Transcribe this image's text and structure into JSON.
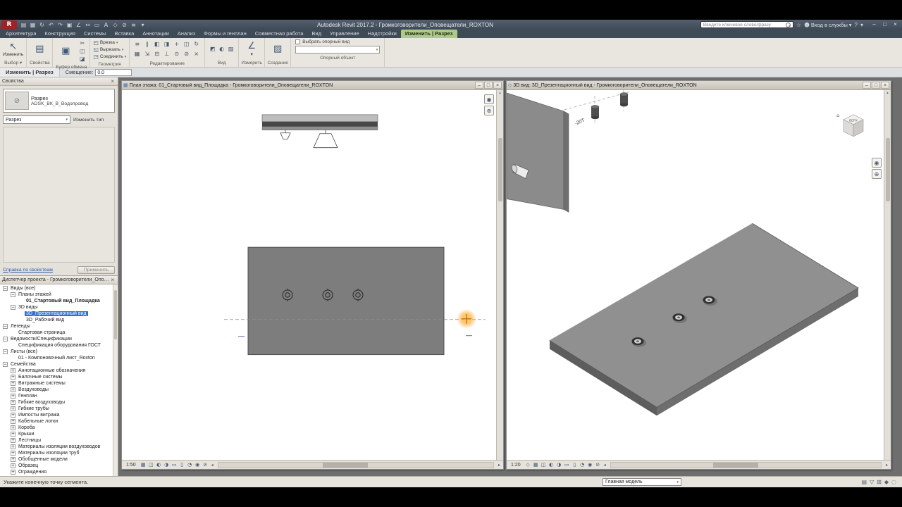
{
  "colors": {
    "tab-green": "#aec98a",
    "selection-blue": "#2f6fd0",
    "highlight-orange": "#ffa726",
    "slab-gray": "#909090"
  },
  "titlebar": {
    "logo_text": "R",
    "logo_arrow": "▾",
    "title": "Autodesk Revit 2017.2 - Громкоговорители_Оповещатели_ROXTON",
    "qat_icons": [
      {
        "name": "open-icon",
        "glyph": "▤"
      },
      {
        "name": "save-icon",
        "glyph": "▦"
      },
      {
        "name": "sync-icon",
        "glyph": "↻"
      },
      {
        "name": "undo-icon",
        "glyph": "↶"
      },
      {
        "name": "redo-icon",
        "glyph": "↷"
      },
      {
        "name": "print-icon",
        "glyph": "▣"
      },
      {
        "name": "measure-icon",
        "glyph": "∠"
      },
      {
        "name": "dimension-icon",
        "glyph": "↔"
      },
      {
        "name": "tag-icon",
        "glyph": "▭"
      },
      {
        "name": "text-icon",
        "glyph": "A"
      },
      {
        "name": "3d-view-icon",
        "glyph": "◇"
      },
      {
        "name": "section-icon",
        "glyph": "⊘"
      },
      {
        "name": "thin-lines-icon",
        "glyph": "≡"
      },
      {
        "name": "switch-windows-icon",
        "glyph": "▾"
      }
    ],
    "search_placeholder": "Введите ключевое слово/фразу",
    "star_icon": "☆",
    "person_icon": "☻",
    "signin_label": "Вход в службы",
    "signin_arrow": "▾",
    "help_label": "?",
    "help_arrow": "▾",
    "window_buttons": {
      "minimize": "–",
      "maximize": "□",
      "close": "×"
    }
  },
  "ribbon": {
    "dropdown_arrow": "▾",
    "tabs": [
      {
        "label": "Архитектура"
      },
      {
        "label": "Конструкция"
      },
      {
        "label": "Системы"
      },
      {
        "label": "Вставка"
      },
      {
        "label": "Аннотации"
      },
      {
        "label": "Анализ"
      },
      {
        "label": "Формы и генплан"
      },
      {
        "label": "Совместная работа"
      },
      {
        "label": "Вид"
      },
      {
        "label": "Управление"
      },
      {
        "label": "Надстройки"
      },
      {
        "label": "Изменить | Разрез",
        "active": true
      }
    ],
    "panels": {
      "select": {
        "label": "Выбор ▾",
        "button_label": "Изменить",
        "button_glyph": "↖"
      },
      "properties": {
        "label": "Свойства",
        "button_glyph": "▤"
      },
      "clipboard": {
        "label": "Буфер обмена",
        "paste_glyph": "▣",
        "small_icons": [
          {
            "name": "cut-icon",
            "glyph": "✂"
          },
          {
            "name": "copy-icon",
            "glyph": "◫"
          },
          {
            "name": "match-type-icon",
            "glyph": "◪"
          }
        ]
      },
      "geometry": {
        "label": "Геометрия",
        "buttons": [
          {
            "name": "cope-button",
            "label": "Врезка",
            "glyph": "◰"
          },
          {
            "name": "cut-geometry-button",
            "label": "Вырезать",
            "glyph": "◱"
          },
          {
            "name": "join-button",
            "label": "Соединить",
            "glyph": "◳"
          }
        ]
      },
      "modify": {
        "label": "Редактирование",
        "icons": [
          {
            "name": "align-icon",
            "glyph": "≡"
          },
          {
            "name": "offset-icon",
            "glyph": "∥"
          },
          {
            "name": "mirror-pick-icon",
            "glyph": "◧"
          },
          {
            "name": "mirror-axis-icon",
            "glyph": "◨"
          },
          {
            "name": "move-icon",
            "glyph": "+"
          },
          {
            "name": "copy-element-icon",
            "glyph": "◫"
          },
          {
            "name": "rotate-icon",
            "glyph": "↻"
          },
          {
            "name": "array-icon",
            "glyph": "▦"
          },
          {
            "name": "scale-icon",
            "glyph": "⇲"
          },
          {
            "name": "split-icon",
            "glyph": "⊟"
          },
          {
            "name": "trim-icon",
            "glyph": "⊥"
          },
          {
            "name": "pin-icon",
            "glyph": "⊙"
          },
          {
            "name": "unpin-icon",
            "glyph": "⊘"
          },
          {
            "name": "delete-icon",
            "glyph": "×"
          }
        ]
      },
      "view": {
        "label": "Вид",
        "icons": [
          {
            "name": "cut-profile-icon",
            "glyph": "◩"
          },
          {
            "name": "show-hidden-icon",
            "glyph": "◐"
          },
          {
            "name": "linework-icon",
            "glyph": "▨"
          }
        ]
      },
      "measure": {
        "label": "Измерить",
        "button_glyph": "∠"
      },
      "create": {
        "label": "Создание",
        "button_glyph": "▧"
      },
      "reference": {
        "label": "Опорный объект",
        "checkbox_label": "Выбрать опорный вид",
        "dropdown_value": ""
      }
    }
  },
  "options_bar": {
    "mode_label": "Изменить | Разрез",
    "offset_label": "Смещение:",
    "offset_value": "0.0"
  },
  "properties": {
    "header": "Свойства",
    "close_glyph": "×",
    "type_name": "Разрез",
    "type_family": "ADSK_ВК_В_Водопровод",
    "preview_glyph": "⊘",
    "selector_value": "Разрез",
    "edit_type_label": "Изменить тип",
    "help_link": "Справка по свойствам",
    "apply_label": "Применить"
  },
  "project_browser": {
    "header": "Диспетчер проекта - Громкоговорители_Оповещатели_ROXTON",
    "close_glyph": "×",
    "items": [
      {
        "label": "Виды (все)",
        "level": 0,
        "expander": "−"
      },
      {
        "label": "Планы этажей",
        "level": 1,
        "expander": "−"
      },
      {
        "label": "01_Стартовый вид_Площадка",
        "level": 2,
        "bold": true
      },
      {
        "label": "3D виды",
        "level": 1,
        "expander": "−"
      },
      {
        "label": "3D_Презентационный вид",
        "level": 2,
        "selected": true
      },
      {
        "label": "3D_Рабочий вид",
        "level": 2
      },
      {
        "label": "Легенды",
        "level": 0,
        "expander": "−"
      },
      {
        "label": "Стартовая страница",
        "level": 1
      },
      {
        "label": "Ведомости/Спецификации",
        "level": 0,
        "expander": "−"
      },
      {
        "label": "Спецификация оборудования ГОСТ",
        "level": 1
      },
      {
        "label": "Листы (все)",
        "level": 0,
        "expander": "−"
      },
      {
        "label": "01 - Компоновочный лист_Roxton",
        "level": 1
      },
      {
        "label": "Семейства",
        "level": 0,
        "expander": "−"
      },
      {
        "label": "Аннотационные обозначения",
        "level": 1,
        "expander": "+"
      },
      {
        "label": "Балочные системы",
        "level": 1,
        "expander": "+"
      },
      {
        "label": "Витражные системы",
        "level": 1,
        "expander": "+"
      },
      {
        "label": "Воздуховоды",
        "level": 1,
        "expander": "+"
      },
      {
        "label": "Генплан",
        "level": 1,
        "expander": "+"
      },
      {
        "label": "Гибкие воздуховоды",
        "level": 1,
        "expander": "+"
      },
      {
        "label": "Гибкие трубы",
        "level": 1,
        "expander": "+"
      },
      {
        "label": "Импосты витража",
        "level": 1,
        "expander": "+"
      },
      {
        "label": "Кабельные лотки",
        "level": 1,
        "expander": "+"
      },
      {
        "label": "Короба",
        "level": 1,
        "expander": "+"
      },
      {
        "label": "Крыши",
        "level": 1,
        "expander": "+"
      },
      {
        "label": "Лестницы",
        "level": 1,
        "expander": "+"
      },
      {
        "label": "Материалы изоляции воздуховодов",
        "level": 1,
        "expander": "+"
      },
      {
        "label": "Материалы изоляции труб",
        "level": 1,
        "expander": "+"
      },
      {
        "label": "Обобщенные модели",
        "level": 1,
        "expander": "+"
      },
      {
        "label": "Образец",
        "level": 1,
        "expander": "+"
      },
      {
        "label": "Ограждения",
        "level": 1,
        "expander": "+"
      }
    ]
  },
  "views": {
    "window_buttons": {
      "minimize": "–",
      "maximize": "□",
      "close": "×"
    },
    "plan": {
      "title_icon": "▦",
      "title": "План этажа: 01_Стартовый вид_Площадка - Громкоговорители_Оповещатели_ROXTON",
      "scale": "1:50",
      "controls": [
        {
          "name": "detail-level-icon",
          "glyph": "▦"
        },
        {
          "name": "visual-style-icon",
          "glyph": "◫"
        },
        {
          "name": "sun-path-icon",
          "glyph": "◐"
        },
        {
          "name": "shadows-icon",
          "glyph": "◑"
        },
        {
          "name": "crop-view-icon",
          "glyph": "▭"
        },
        {
          "name": "crop-visibility-icon",
          "glyph": "▯"
        },
        {
          "name": "temporary-hide-icon",
          "glyph": "◔"
        },
        {
          "name": "reveal-hidden-icon",
          "glyph": "◉"
        },
        {
          "name": "constraints-icon",
          "glyph": "⊘"
        }
      ],
      "nav_icons": [
        {
          "name": "steering-wheel-icon",
          "glyph": "◉"
        },
        {
          "name": "zoom-icon",
          "glyph": "⊕"
        }
      ],
      "scroll_arrows": {
        "left": "◂",
        "right": "▸",
        "up": "▴",
        "down": "▾"
      }
    },
    "view3d": {
      "title_icon": "◇",
      "title": "3D вид: 3D_Презентационный вид - Громкоговорители_Оповещатели_ROXTON",
      "scale": "1:20",
      "controls": [
        {
          "name": "perspective-icon",
          "glyph": "◇"
        },
        {
          "name": "detail-level-icon",
          "glyph": "▦"
        },
        {
          "name": "visual-style-icon",
          "glyph": "◫"
        },
        {
          "name": "sun-path-icon",
          "glyph": "◐"
        },
        {
          "name": "shadows-icon",
          "glyph": "◑"
        },
        {
          "name": "crop-view-icon",
          "glyph": "▭"
        },
        {
          "name": "crop-visibility-icon",
          "glyph": "▯"
        },
        {
          "name": "temporary-hide-icon",
          "glyph": "◔"
        },
        {
          "name": "reveal-hidden-icon",
          "glyph": "◉"
        },
        {
          "name": "constraints-icon",
          "glyph": "⊘"
        }
      ],
      "nav_icons": [
        {
          "name": "steering-wheel-icon",
          "glyph": "◉"
        },
        {
          "name": "pan-icon",
          "glyph": "⊕"
        }
      ],
      "viewcube_label": "ВЕРХ",
      "home_icon": "⌂",
      "annotation_label": "-20Т",
      "scroll_arrows": {
        "left": "◂",
        "right": "▸",
        "up": "▴",
        "down": "▾"
      }
    }
  },
  "status_bar": {
    "message": "Укажите конечную точку сегмента.",
    "design_option_value": "Главная модель",
    "dropdown_arrow": "▾",
    "icons": [
      {
        "name": "worksets-icon",
        "glyph": "▤"
      },
      {
        "name": "filter-icon",
        "glyph": "▽"
      },
      {
        "name": "select-link-icon",
        "glyph": "⊞"
      },
      {
        "name": "drag-elements-icon",
        "glyph": "◆"
      },
      {
        "name": "background-process-icon",
        "glyph": "◌"
      }
    ]
  }
}
